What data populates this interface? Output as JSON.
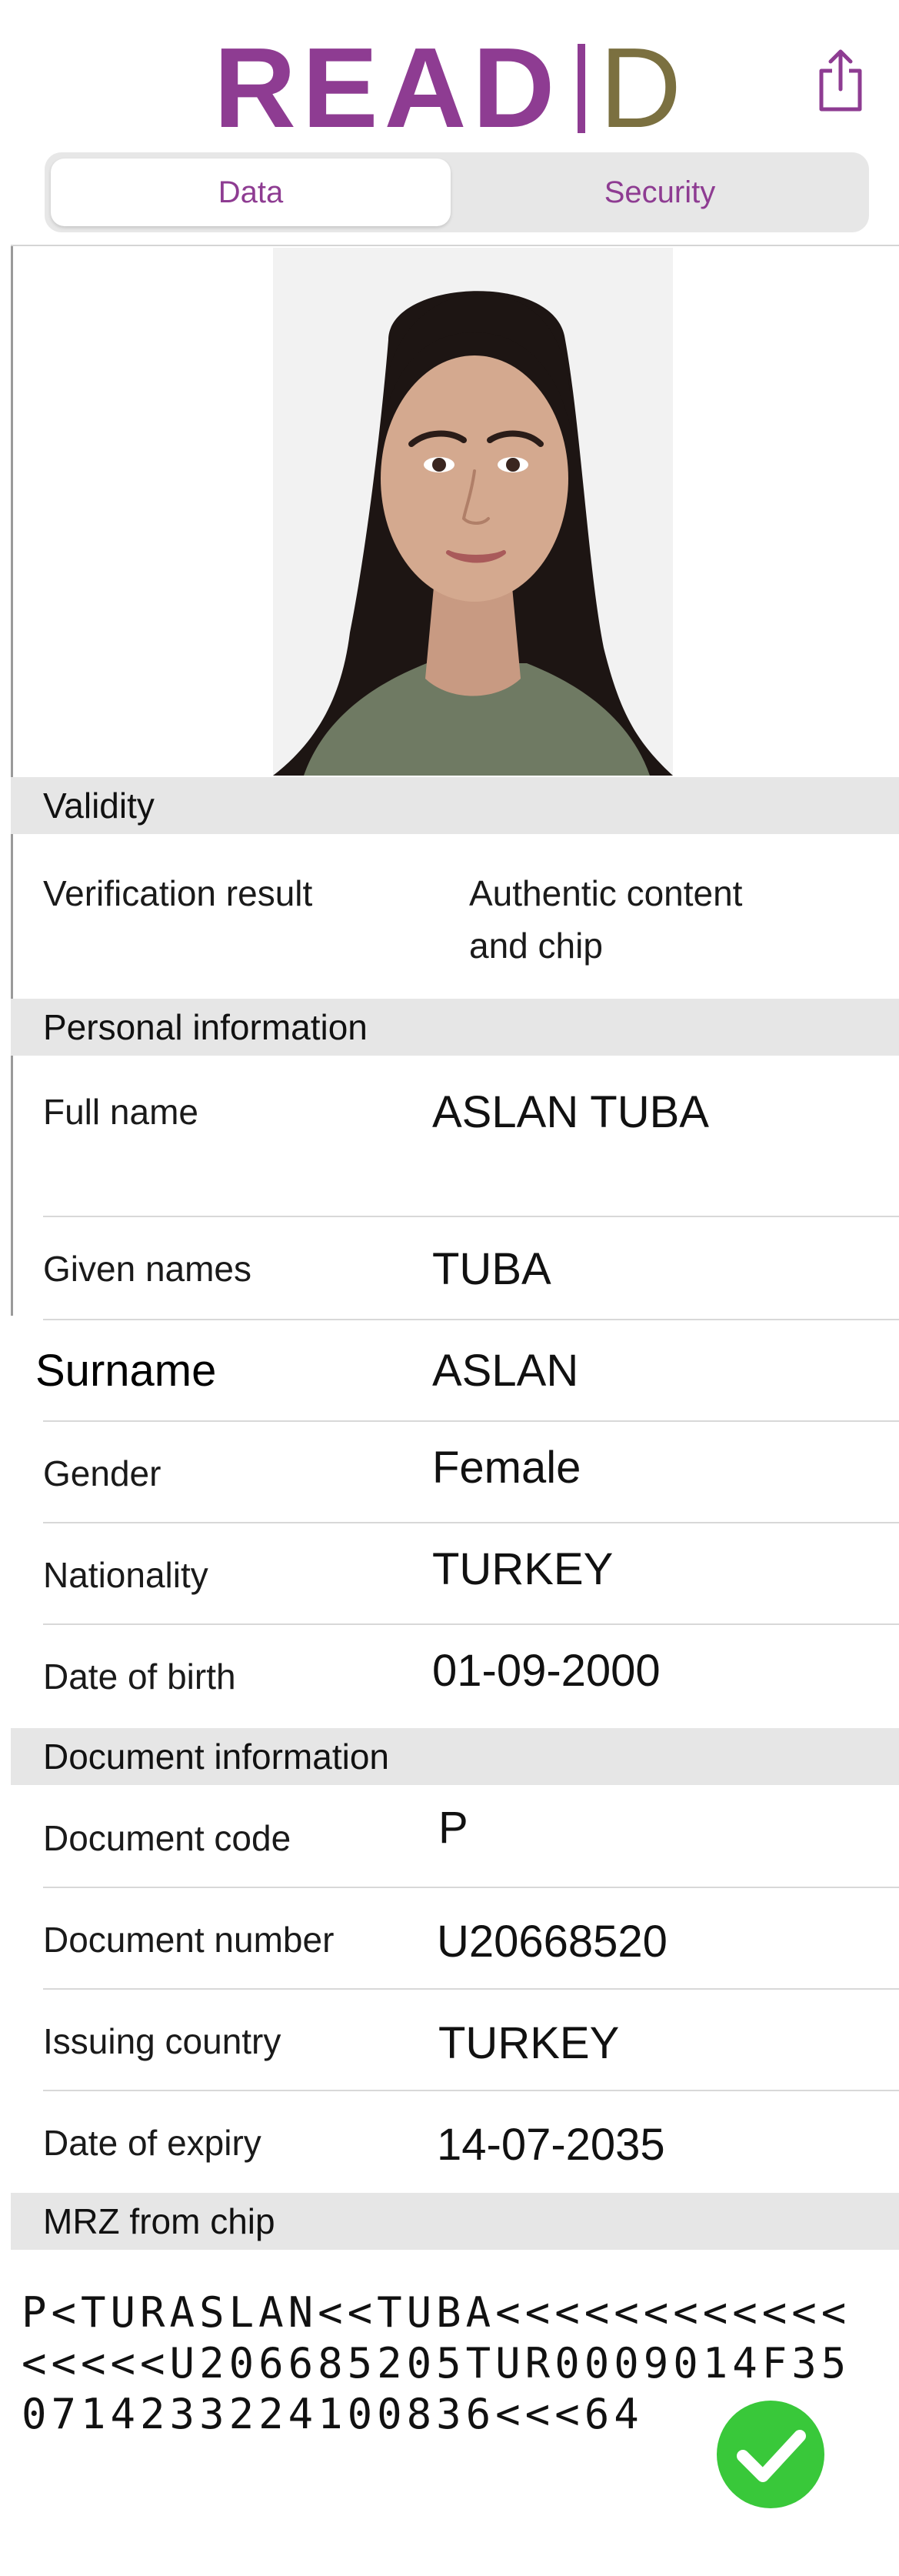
{
  "header": {
    "logo_read": "READ",
    "logo_d": "D",
    "share_icon": "share-icon"
  },
  "tabs": [
    {
      "label": "Data",
      "selected": true
    },
    {
      "label": "Security",
      "selected": false
    }
  ],
  "colors": {
    "brand_purple": "#8e3c92",
    "brand_olive": "#7b7040",
    "success_green": "#39c83a"
  },
  "validity": {
    "title": "Validity",
    "verification_label": "Verification result",
    "verification_value_line1": "Authentic content",
    "verification_value_line2": "and chip"
  },
  "personal": {
    "title": "Personal information",
    "rows": [
      {
        "label": "Full name",
        "value": "ASLAN TUBA"
      },
      {
        "label": "Given names",
        "value": "TUBA"
      },
      {
        "label": "Surname",
        "value": "ASLAN"
      },
      {
        "label": "Gender",
        "value": "Female"
      },
      {
        "label": "Nationality",
        "value": "TURKEY"
      },
      {
        "label": "Date of birth",
        "value": "01-09-2000"
      }
    ]
  },
  "document": {
    "title": "Document information",
    "rows": [
      {
        "label": "Document code",
        "value": "P"
      },
      {
        "label": "Document number",
        "value": "U20668520"
      },
      {
        "label": "Issuing country",
        "value": "TURKEY"
      },
      {
        "label": "Date of expiry",
        "value": "14-07-2035"
      }
    ]
  },
  "mrz": {
    "title": "MRZ from chip",
    "lines": [
      "P<TURASLAN<<TUBA<<<<<<<<<<<<",
      "<<<<<U206685205TUR0009014F35",
      "0714233224100836<<<64"
    ]
  },
  "status_icon": "check-circle-icon"
}
